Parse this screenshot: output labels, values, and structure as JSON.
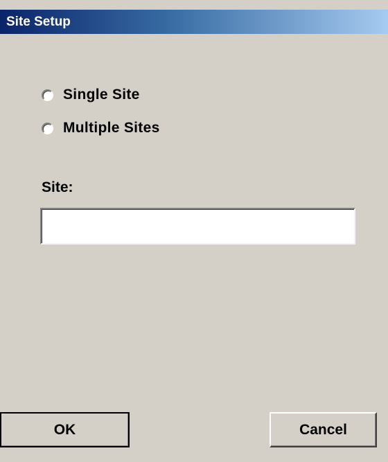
{
  "window": {
    "title": "Site Setup"
  },
  "mode_options": [
    {
      "label": "Single Site",
      "selected": false
    },
    {
      "label": "Multiple Sites",
      "selected": false
    }
  ],
  "site_field": {
    "label": "Site:",
    "value": ""
  },
  "buttons": {
    "ok_label": "OK",
    "cancel_label": "Cancel"
  },
  "colors": {
    "title_gradient_start": "#0a246a",
    "title_gradient_end": "#a6caf0",
    "dialog_background": "#d4d0c8"
  }
}
